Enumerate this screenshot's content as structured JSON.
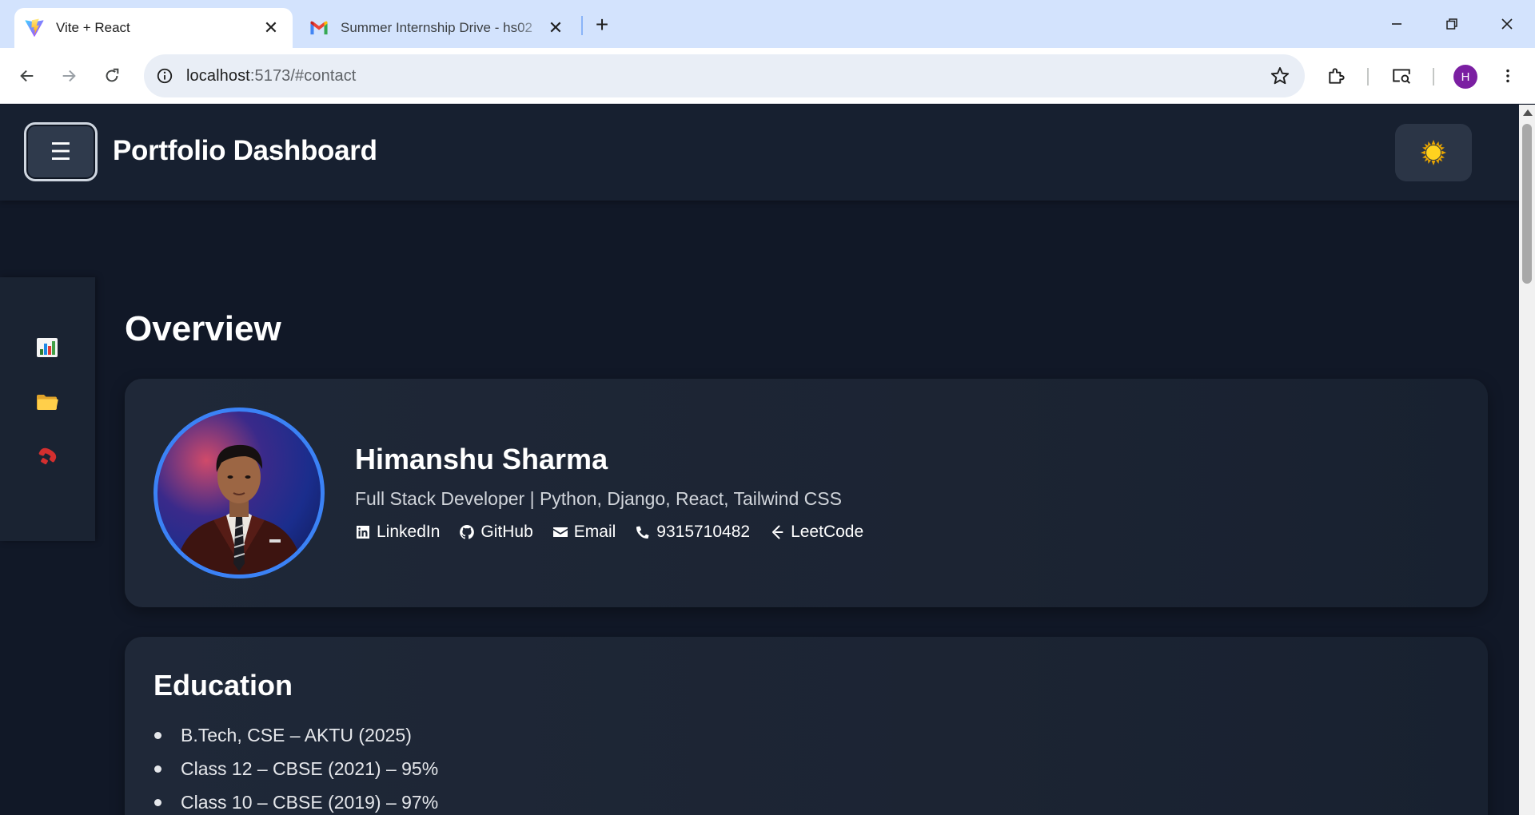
{
  "browser": {
    "tabs": [
      {
        "title": "Vite + React",
        "active": true,
        "favicon": "vite-icon"
      },
      {
        "title": "Summer Internship Drive - hs02",
        "active": false,
        "favicon": "gmail-icon"
      }
    ],
    "url_host": "localhost",
    "url_path": ":5173/#contact",
    "profile_initial": "H"
  },
  "app": {
    "menu_glyph": "☰",
    "title": "Portfolio Dashboard",
    "theme_toggle_icon": "sun-icon"
  },
  "sidebar": {
    "items": [
      {
        "icon": "bar-chart-icon",
        "target": "overview"
      },
      {
        "icon": "folder-icon",
        "target": "projects"
      },
      {
        "icon": "phone-icon",
        "target": "contact"
      }
    ]
  },
  "overview": {
    "section_title": "Overview",
    "name": "Himanshu Sharma",
    "role": "Full Stack Developer | Python, Django, React, Tailwind CSS",
    "links": [
      {
        "label": "LinkedIn",
        "icon": "linkedin-icon"
      },
      {
        "label": "GitHub",
        "icon": "github-icon"
      },
      {
        "label": "Email",
        "icon": "envelope-icon"
      },
      {
        "label": "9315710482",
        "icon": "phone-icon"
      },
      {
        "label": "LeetCode",
        "icon": "leetcode-icon"
      }
    ]
  },
  "education": {
    "title": "Education",
    "items": [
      "B.Tech, CSE – AKTU (2025)",
      "Class 12 – CBSE (2021) – 95%",
      "Class 10 – CBSE (2019) – 97%"
    ]
  },
  "colors": {
    "page_bg": "#111827",
    "header_bg": "#172030",
    "card_bg": "#1f2838",
    "avatar_ring": "#3b82f6",
    "tabstrip": "#d3e3fd"
  }
}
